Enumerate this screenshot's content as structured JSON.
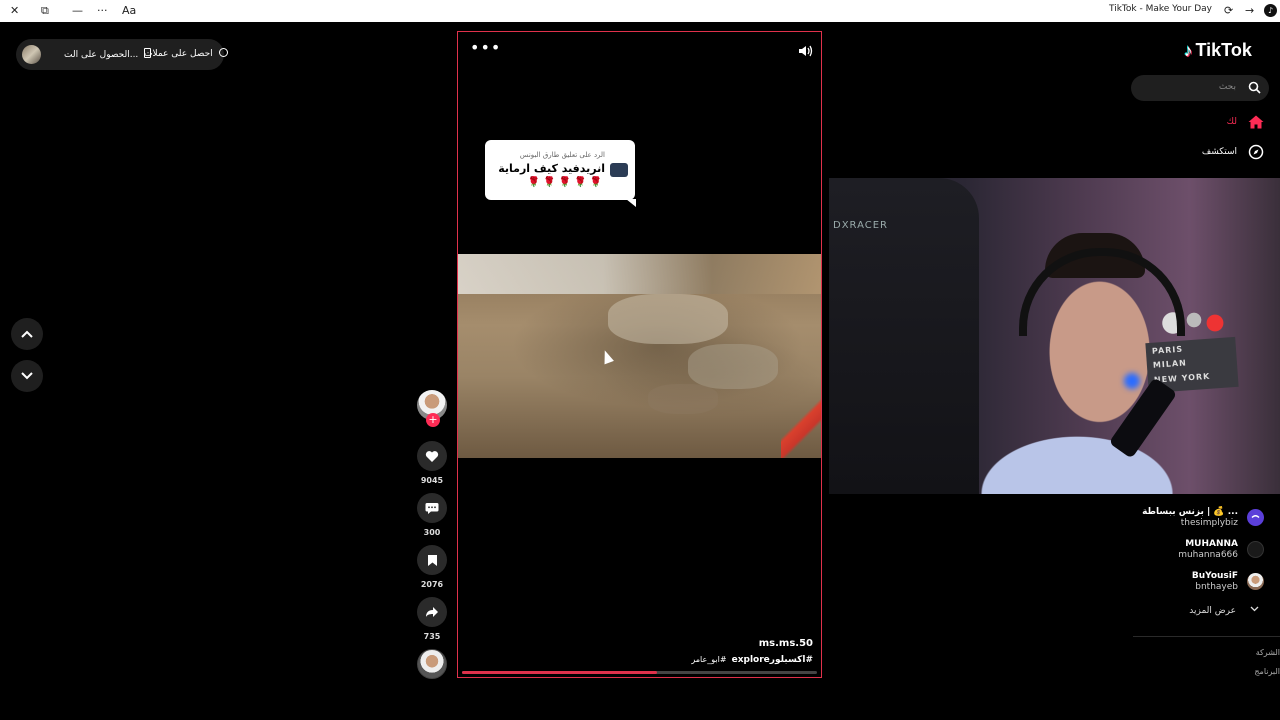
{
  "window": {
    "title": "TikTok - Make Your Day",
    "icons": [
      "close-icon",
      "restore-icon",
      "minimize-icon",
      "more-icon",
      "reader-icon",
      "refresh-icon",
      "forward-icon",
      "tiktok-favicon-icon"
    ]
  },
  "top_left": {
    "get_coins_label": "احصل على عملات",
    "get_app_label": "الحصول على الت..."
  },
  "video": {
    "reply_sticker": {
      "reply_line": "الرد على تعليق طارق البونس",
      "main_text": "انريدفيد كيف ارماية",
      "emojis": "🌹🌹🌹🌹🌹"
    },
    "author": "ms.ms.50",
    "hashtags": {
      "tag1": "#اكسبلور",
      "tag2": "explore",
      "tag3": "#ابو_عامر"
    },
    "progress": 0.55
  },
  "actions": {
    "likes": "9045",
    "comments": "300",
    "saves": "2076",
    "shares": "735"
  },
  "sidebar": {
    "logo_text": "TikTok",
    "search_placeholder": "بحث",
    "nav": {
      "for_you": "لك",
      "explore": "استكشف"
    },
    "following": [
      {
        "name": "بزنس ببساطة |  💰 ...",
        "handle": "thesimplybiz",
        "avatar_color": "#5b3fd9"
      },
      {
        "name": "MUHANNA",
        "handle": "muhanna666",
        "avatar_color": "#222222"
      },
      {
        "name": "BuYousiF",
        "handle": "bnthayeb",
        "avatar_color": "#8a6a55"
      }
    ],
    "show_more": "عرض المزيد",
    "footer": {
      "company": "الشركة",
      "program": "البرنامج"
    }
  },
  "webcam": {
    "chair_brand": "DXRACER",
    "sign_lines": [
      "PARIS",
      "MILAN",
      "NEW YORK"
    ]
  },
  "colors": {
    "accent": "#fe2c55",
    "frame_border": "#e0314b",
    "background": "#000000"
  }
}
